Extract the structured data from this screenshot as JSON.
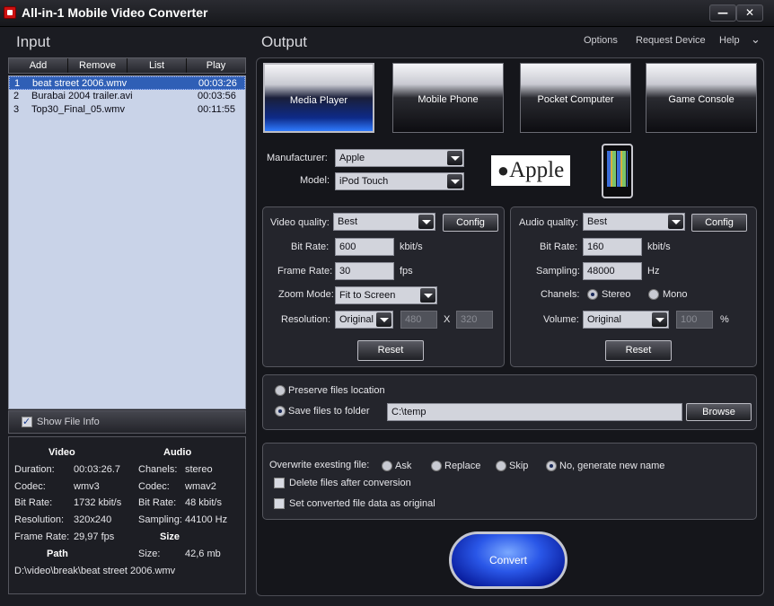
{
  "window": {
    "title": "All-in-1 Mobile Video Converter",
    "minimize": "—",
    "close": "✕"
  },
  "input": {
    "heading": "Input",
    "toolbar": [
      "Add",
      "Remove",
      "List",
      "Play"
    ],
    "files": [
      {
        "num": "1",
        "name": "beat street 2006.wmv",
        "duration": "00:03:26"
      },
      {
        "num": "2",
        "name": "Burabai 2004 trailer.avi",
        "duration": "00:03:56"
      },
      {
        "num": "3",
        "name": "Top30_Final_05.wmv",
        "duration": "00:11:55"
      }
    ],
    "show_file_info": "Show File Info"
  },
  "info": {
    "video_heading": "Video",
    "audio_heading": "Audio",
    "duration_label": "Duration:",
    "duration": "00:03:26.7",
    "codec_label": "Codec:",
    "codec": "wmv3",
    "bitrate_label": "Bit Rate:",
    "bitrate": "1732 kbit/s",
    "resolution_label": "Resolution:",
    "resolution": "320x240",
    "framerate_label": "Frame Rate:",
    "framerate": "29,97 fps",
    "chanels_label": "Chanels:",
    "chanels": "stereo",
    "acodec_label": "Codec:",
    "acodec": "wmav2",
    "abitrate_label": "Bit Rate:",
    "abitrate": "48 kbit/s",
    "sampling_label": "Sampling:",
    "sampling": "44100 Hz",
    "size_heading": "Size",
    "size_label": "Size:",
    "size": "42,6 mb",
    "path_heading": "Path",
    "path": "D:\\video\\break\\beat street 2006.wmv"
  },
  "output": {
    "heading": "Output",
    "links": [
      "Options",
      "Request Device",
      "Help"
    ],
    "categories": [
      "Media Player",
      "Mobile Phone",
      "Pocket Computer",
      "Game Console"
    ],
    "manufacturer_label": "Manufacturer:",
    "manufacturer": "Apple",
    "model_label": "Model:",
    "model": "iPod Touch",
    "brand_logo": "Apple",
    "video": {
      "quality_label": "Video quality:",
      "quality": "Best",
      "config": "Config",
      "bitrate_label": "Bit Rate:",
      "bitrate": "600",
      "bitrate_unit": "kbit/s",
      "framerate_label": "Frame Rate:",
      "framerate": "30",
      "framerate_unit": "fps",
      "zoom_label": "Zoom Mode:",
      "zoom": "Fit to Screen",
      "resolution_label": "Resolution:",
      "resolution": "Original",
      "width": "480",
      "x": "X",
      "height": "320",
      "reset": "Reset"
    },
    "audio": {
      "quality_label": "Audio quality:",
      "quality": "Best",
      "config": "Config",
      "bitrate_label": "Bit Rate:",
      "bitrate": "160",
      "bitrate_unit": "kbit/s",
      "sampling_label": "Sampling:",
      "sampling": "48000",
      "sampling_unit": "Hz",
      "chanels_label": "Chanels:",
      "stereo": "Stereo",
      "mono": "Mono",
      "volume_label": "Volume:",
      "volume": "Original",
      "volume_value": "100",
      "volume_unit": "%",
      "reset": "Reset"
    },
    "location": {
      "preserve": "Preserve files location",
      "save_to": "Save files to folder",
      "folder": "C:\\temp",
      "browse": "Browse"
    },
    "overwrite": {
      "label": "Overwrite exesting file:",
      "ask": "Ask",
      "replace": "Replace",
      "skip": "Skip",
      "no": "No, generate new name",
      "delete_after": "Delete files after conversion",
      "set_original": "Set converted file data as original"
    },
    "convert": "Convert"
  }
}
